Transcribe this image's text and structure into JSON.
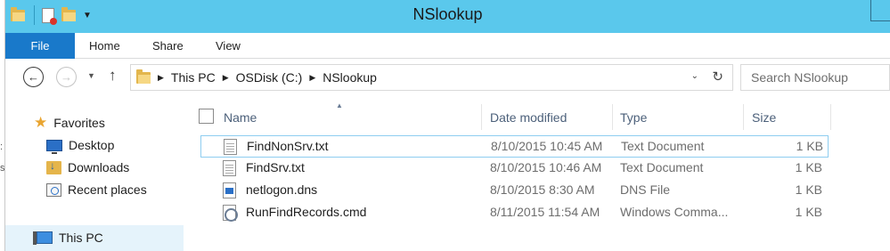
{
  "window": {
    "title": "NSlookup"
  },
  "ribbon": {
    "tabs": [
      {
        "label": "File"
      },
      {
        "label": "Home"
      },
      {
        "label": "Share"
      },
      {
        "label": "View"
      }
    ]
  },
  "address": {
    "crumbs": [
      "This PC",
      "OSDisk (C:)",
      "NSlookup"
    ]
  },
  "search": {
    "placeholder": "Search NSlookup"
  },
  "nav_pane": {
    "favorites_label": "Favorites",
    "items": [
      {
        "label": "Desktop",
        "icon": "desktop-icon"
      },
      {
        "label": "Downloads",
        "icon": "downloads-icon"
      },
      {
        "label": "Recent places",
        "icon": "recent-places-icon"
      }
    ],
    "this_pc_label": "This PC"
  },
  "file_list": {
    "columns": [
      "Name",
      "Date modified",
      "Type",
      "Size"
    ],
    "rows": [
      {
        "name": "FindNonSrv.txt",
        "date": "8/10/2015 10:45 AM",
        "type": "Text Document",
        "size": "1 KB",
        "icon": "text-file-icon",
        "selected": true
      },
      {
        "name": "FindSrv.txt",
        "date": "8/10/2015 10:46 AM",
        "type": "Text Document",
        "size": "1 KB",
        "icon": "text-file-icon",
        "selected": false
      },
      {
        "name": "netlogon.dns",
        "date": "8/10/2015 8:30 AM",
        "type": "DNS File",
        "size": "1 KB",
        "icon": "dns-file-icon",
        "selected": false
      },
      {
        "name": "RunFindRecords.cmd",
        "date": "8/11/2015 11:54 AM",
        "type": "Windows Comma...",
        "size": "1 KB",
        "icon": "cmd-file-icon",
        "selected": false
      }
    ]
  },
  "colors": {
    "titlebar": "#5ac8ec",
    "file_tab": "#1979ca",
    "selection_border": "#8ecdf0",
    "nav_selected": "#e5f3fb"
  }
}
